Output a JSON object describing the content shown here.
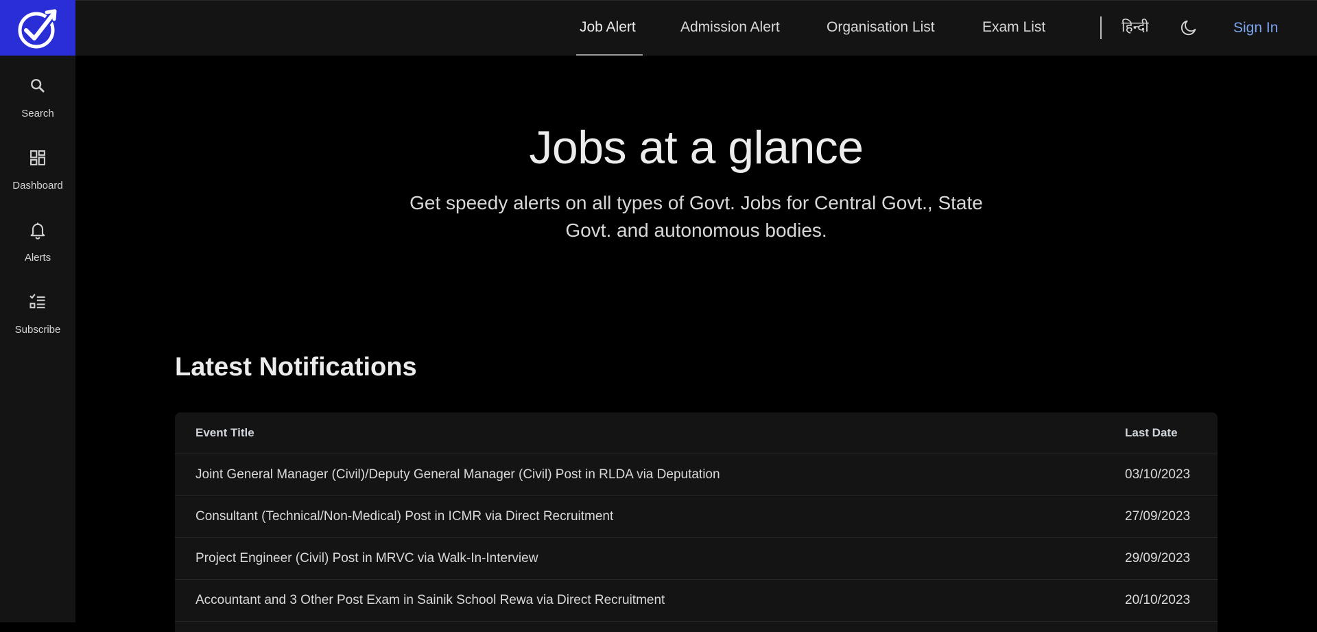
{
  "nav": {
    "items": [
      {
        "label": "Job Alert",
        "active": true
      },
      {
        "label": "Admission Alert",
        "active": false
      },
      {
        "label": "Organisation List",
        "active": false
      },
      {
        "label": "Exam List",
        "active": false
      }
    ],
    "language_label": "हिन्दी",
    "theme_icon": "moon-icon",
    "signin_label": "Sign In"
  },
  "sidebar": {
    "items": [
      {
        "label": "Search",
        "icon": "search-icon"
      },
      {
        "label": "Dashboard",
        "icon": "dashboard-icon"
      },
      {
        "label": "Alerts",
        "icon": "bell-icon"
      },
      {
        "label": "Subscribe",
        "icon": "checklist-icon"
      }
    ]
  },
  "hero": {
    "title": "Jobs at a glance",
    "subtitle": "Get speedy alerts on all types of Govt. Jobs for Central Govt., State Govt. and autonomous bodies."
  },
  "notifications": {
    "title": "Latest Notifications",
    "headers": {
      "title": "Event Title",
      "date": "Last Date"
    },
    "rows": [
      {
        "title": "Joint General Manager (Civil)/Deputy General Manager (Civil) Post in RLDA via Deputation",
        "date": "03/10/2023"
      },
      {
        "title": "Consultant (Technical/Non-Medical) Post in ICMR via Direct Recruitment",
        "date": "27/09/2023"
      },
      {
        "title": "Project Engineer (Civil) Post in MRVC via Walk-In-Interview",
        "date": "29/09/2023"
      },
      {
        "title": "Accountant and 3 Other Post Exam in Sainik School Rewa via Direct Recruitment",
        "date": "20/10/2023"
      }
    ]
  },
  "colors": {
    "brand": "#2a2ed6",
    "link": "#7fa6f0",
    "panel": "#141414",
    "background": "#000000"
  }
}
